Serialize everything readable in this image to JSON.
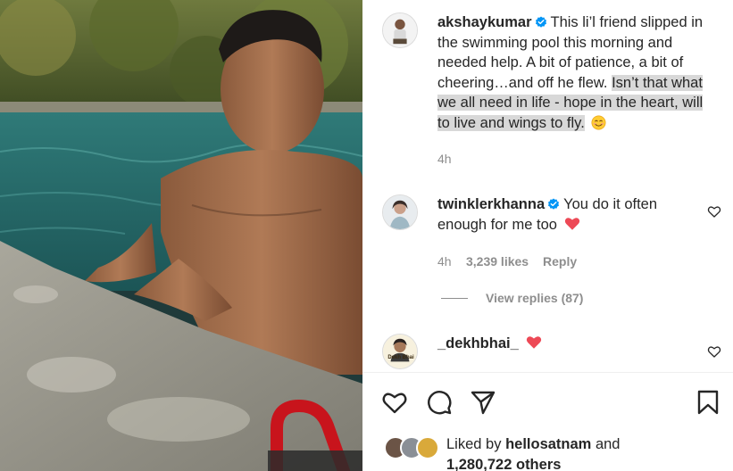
{
  "post": {
    "author": "akshaykumar",
    "caption_plain": "This li’l friend slipped in the swimming pool this morning and needed help. A bit of patience, a bit of cheering…and off he flew.",
    "caption_highlight": "Isn’t that what we all need in life - hope in the heart, will to live and wings to fly.",
    "time": "4h"
  },
  "comments": [
    {
      "user": "twinklerkhanna",
      "text": "You do it often enough for me too",
      "time": "4h",
      "likes": "3,239 likes",
      "reply_label": "Reply",
      "view_replies": "View replies (87)"
    },
    {
      "user": "_dekhbhai_",
      "avatar_text": "Dekh Bhai"
    }
  ],
  "likes": {
    "prefix": "Liked by",
    "user": "hellosatnam",
    "connector": "and",
    "others": "1,280,722 others"
  },
  "colors": {
    "verified": "#0095f6",
    "heart": "#ed4956",
    "text": "#262626",
    "muted": "#8e8e8e",
    "highlight": "#d8d8d8"
  },
  "icons": [
    "verified-badge-icon",
    "smiling-face-icon",
    "red-heart-icon",
    "like-heart-icon",
    "comment-icon",
    "share-icon",
    "bookmark-icon"
  ]
}
